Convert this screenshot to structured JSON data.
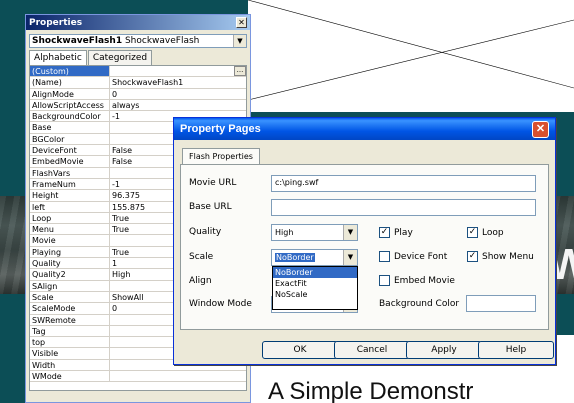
{
  "background": {
    "caption": "A Simple Demonstr",
    "banner_letter": "W"
  },
  "properties_window": {
    "title": "Properties",
    "object_name": "ShockwaveFlash1",
    "object_type": "ShockwaveFlash",
    "tabs": [
      {
        "label": "Alphabetic",
        "active": true
      },
      {
        "label": "Categorized",
        "active": false
      }
    ],
    "rows": [
      {
        "name": "(Custom)",
        "value": "",
        "selected": true
      },
      {
        "name": "(Name)",
        "value": "ShockwaveFlash1"
      },
      {
        "name": "AlignMode",
        "value": "0"
      },
      {
        "name": "AllowScriptAccess",
        "value": "always"
      },
      {
        "name": "BackgroundColor",
        "value": "-1"
      },
      {
        "name": "Base",
        "value": ""
      },
      {
        "name": "BGColor",
        "value": ""
      },
      {
        "name": "DeviceFont",
        "value": "False"
      },
      {
        "name": "EmbedMovie",
        "value": "False"
      },
      {
        "name": "FlashVars",
        "value": ""
      },
      {
        "name": "FrameNum",
        "value": "-1"
      },
      {
        "name": "Height",
        "value": "96.375"
      },
      {
        "name": "left",
        "value": "155.875"
      },
      {
        "name": "Loop",
        "value": "True"
      },
      {
        "name": "Menu",
        "value": "True"
      },
      {
        "name": "Movie",
        "value": ""
      },
      {
        "name": "Playing",
        "value": "True"
      },
      {
        "name": "Quality",
        "value": "1"
      },
      {
        "name": "Quality2",
        "value": "High"
      },
      {
        "name": "SAlign",
        "value": ""
      },
      {
        "name": "Scale",
        "value": "ShowAll"
      },
      {
        "name": "ScaleMode",
        "value": "0"
      },
      {
        "name": "SWRemote",
        "value": ""
      },
      {
        "name": "Tag",
        "value": ""
      },
      {
        "name": "top",
        "value": ""
      },
      {
        "name": "Visible",
        "value": ""
      },
      {
        "name": "Width",
        "value": ""
      },
      {
        "name": "WMode",
        "value": ""
      }
    ]
  },
  "dialog": {
    "title": "Property Pages",
    "tab": "Flash Properties",
    "movie_url_label": "Movie URL",
    "movie_url_value": "c:\\ping.swf",
    "base_url_label": "Base URL",
    "base_url_value": "",
    "quality_label": "Quality",
    "quality_value": "High",
    "scale_label": "Scale",
    "scale_value": "NoBorder",
    "align_label": "Align",
    "window_mode_label": "Window Mode",
    "scale_options": [
      "NoBorder",
      "ExactFit",
      "NoScale"
    ],
    "play_label": "Play",
    "loop_label": "Loop",
    "device_font_label": "Device Font",
    "show_menu_label": "Show Menu",
    "embed_movie_label": "Embed Movie",
    "background_color_label": "Background Color",
    "checks": {
      "play": true,
      "loop": true,
      "device_font": false,
      "show_menu": true,
      "embed_movie": false
    },
    "ok_label": "OK",
    "cancel_label": "Cancel",
    "apply_label": "Apply",
    "help_label": "Help"
  }
}
